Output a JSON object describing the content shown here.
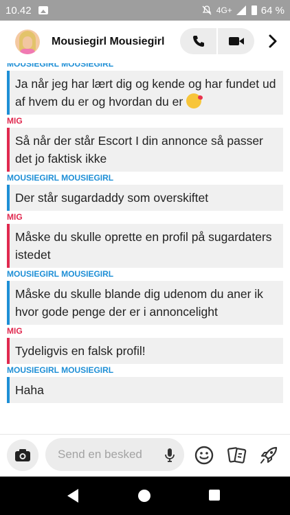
{
  "status_bar": {
    "time": "10.42",
    "network": "4G+",
    "battery": "64 %"
  },
  "header": {
    "title": "Mousiegirl Mousiegirl"
  },
  "messages": [
    {
      "from": "them",
      "sender": "MOUSIEGIRL MOUSIEGIRL",
      "text": "Ja når jeg har lært dig og kende og har fundet ud af hvem du er og hvordan du er",
      "emoji": "kissing-face-emoji"
    },
    {
      "from": "me",
      "sender": "MIG",
      "text": "Så når der står Escort I din annonce så passer det jo faktisk ikke"
    },
    {
      "from": "them",
      "sender": "MOUSIEGIRL MOUSIEGIRL",
      "text": "Der står sugardaddy som overskiftet"
    },
    {
      "from": "me",
      "sender": "MIG",
      "text": "Måske du skulle oprette en profil på sugardaters istedet"
    },
    {
      "from": "them",
      "sender": "MOUSIEGIRL MOUSIEGIRL",
      "text": "Måske du skulle blande dig udenom du aner ik hvor gode penge der er i annoncelight"
    },
    {
      "from": "me",
      "sender": "MIG",
      "text": "Tydeligvis en falsk profil!"
    },
    {
      "from": "them",
      "sender": "MOUSIEGIRL MOUSIEGIRL",
      "text": "Haha"
    }
  ],
  "composer": {
    "placeholder": "Send en besked"
  },
  "colors": {
    "them_accent": "#1e8fd6",
    "me_accent": "#e0294f",
    "bubble_bg": "#f0f0f0"
  }
}
